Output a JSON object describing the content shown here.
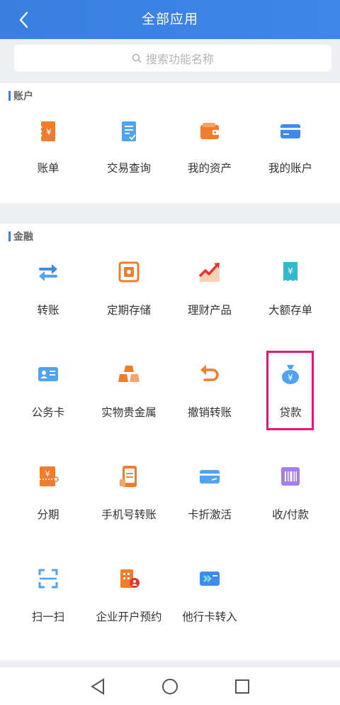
{
  "header": {
    "title": "全部应用"
  },
  "search": {
    "placeholder": "搜索功能名称"
  },
  "sections": [
    {
      "title": "账户",
      "items": [
        {
          "label": "账单",
          "icon": "bill-icon"
        },
        {
          "label": "交易查询",
          "icon": "transaction-query-icon"
        },
        {
          "label": "我的资产",
          "icon": "wallet-icon"
        },
        {
          "label": "我的账户",
          "icon": "card-icon"
        }
      ]
    },
    {
      "title": "金融",
      "items": [
        {
          "label": "转账",
          "icon": "transfer-icon"
        },
        {
          "label": "定期存储",
          "icon": "fixed-deposit-icon"
        },
        {
          "label": "理财产品",
          "icon": "trend-chart-icon"
        },
        {
          "label": "大额存单",
          "icon": "receipt-icon"
        },
        {
          "label": "公务卡",
          "icon": "id-card-icon"
        },
        {
          "label": "实物贵金属",
          "icon": "gold-bars-icon"
        },
        {
          "label": "撤销转账",
          "icon": "undo-icon"
        },
        {
          "label": "贷款",
          "icon": "money-bag-icon"
        },
        {
          "label": "分期",
          "icon": "installment-icon"
        },
        {
          "label": "手机号转账",
          "icon": "phone-transfer-icon"
        },
        {
          "label": "卡折激活",
          "icon": "card-activate-icon"
        },
        {
          "label": "收/付款",
          "icon": "barcode-icon"
        },
        {
          "label": "扫一扫",
          "icon": "scan-icon"
        },
        {
          "label": "企业开户预约",
          "icon": "enterprise-account-icon"
        },
        {
          "label": "他行卡转入",
          "icon": "card-transfer-in-icon"
        }
      ]
    }
  ],
  "colors": {
    "header": "#3f86ea",
    "accent_orange": "#f07c2e",
    "accent_blue": "#3d8bea",
    "highlight": "#e5177a"
  }
}
